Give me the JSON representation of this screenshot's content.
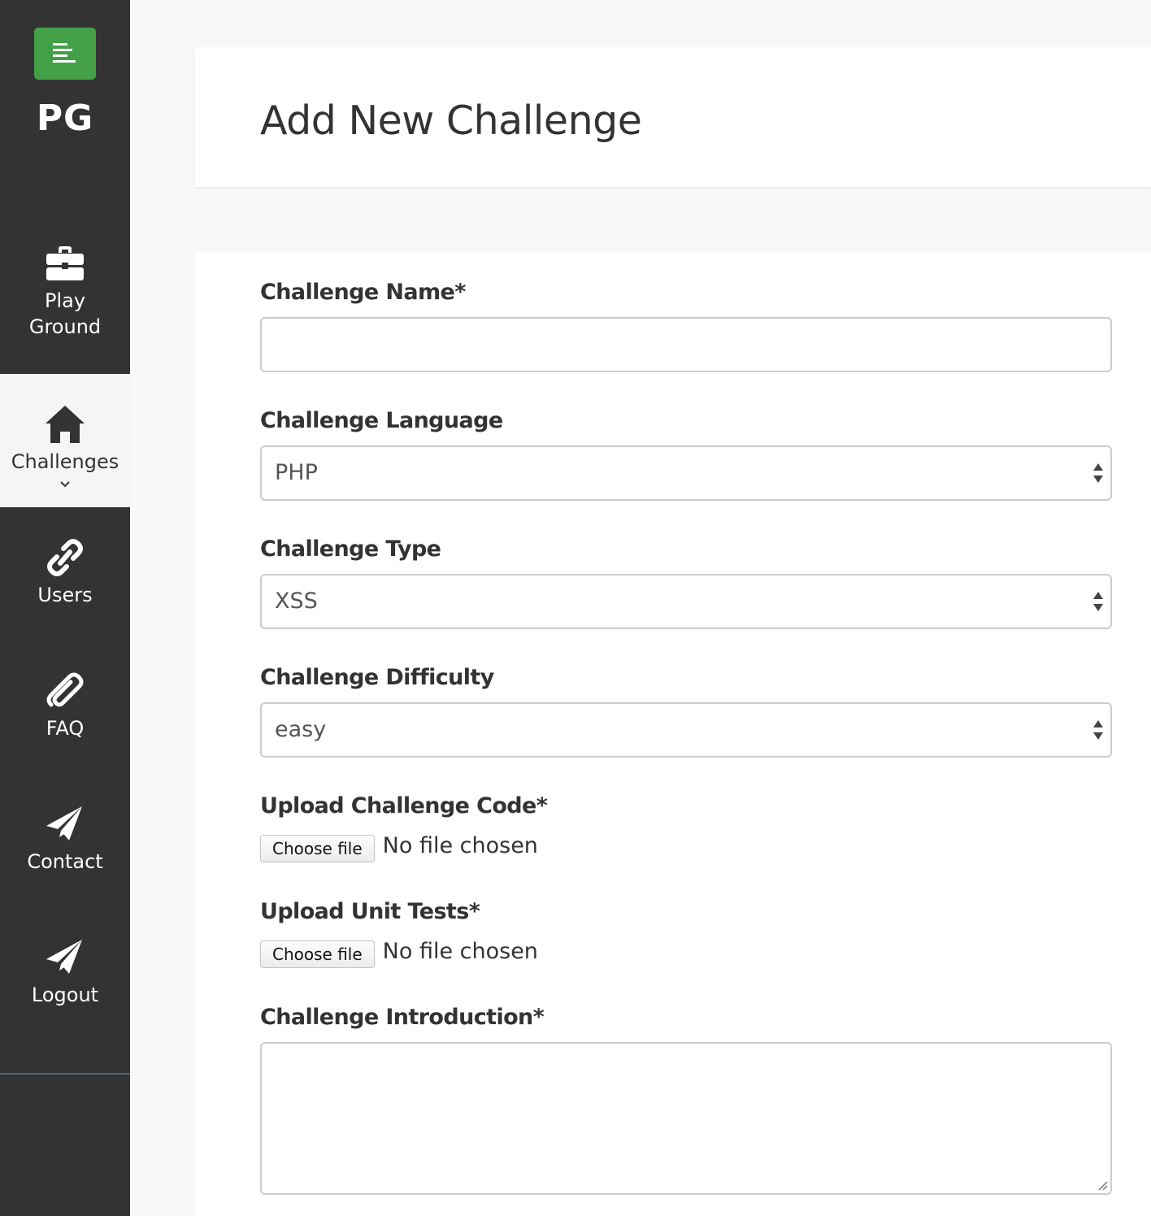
{
  "sidebar": {
    "brand": "PG",
    "logo_color": "#43a047",
    "items": [
      {
        "label_line1": "Play",
        "label_line2": "Ground",
        "icon": "briefcase-icon"
      },
      {
        "label": "Challenges",
        "icon": "home-icon",
        "active": true
      },
      {
        "label": "Users",
        "icon": "link-icon"
      },
      {
        "label": "FAQ",
        "icon": "paperclip-icon"
      },
      {
        "label": "Contact",
        "icon": "paper-plane-icon"
      },
      {
        "label": "Logout",
        "icon": "paper-plane-icon"
      }
    ]
  },
  "header": {
    "title": "Add New Challenge"
  },
  "form": {
    "name_label": "Challenge Name*",
    "name_value": "",
    "language_label": "Challenge Language",
    "language_value": "PHP",
    "type_label": "Challenge Type",
    "type_value": "XSS",
    "difficulty_label": "Challenge Difficulty",
    "difficulty_value": "easy",
    "code_label": "Upload Challenge Code*",
    "code_button": "Choose file",
    "code_status": "No file chosen",
    "tests_label": "Upload Unit Tests*",
    "tests_button": "Choose file",
    "tests_status": "No file chosen",
    "intro_label": "Challenge Introduction*",
    "intro_value": ""
  }
}
